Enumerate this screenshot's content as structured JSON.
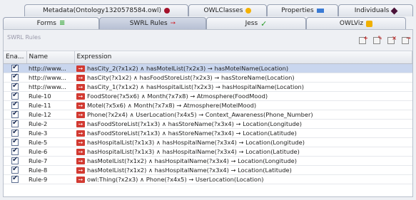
{
  "tabs_row1": [
    {
      "label": "Metadata(Ontology1320578584.owl)",
      "icon": "metadata-icon"
    },
    {
      "label": "OWLClasses",
      "icon": "owl-classes-icon"
    },
    {
      "label": "Properties",
      "icon": "properties-icon"
    },
    {
      "label": "Individuals",
      "icon": "individuals-icon"
    }
  ],
  "tabs_row2": [
    {
      "label": "Forms",
      "icon": "forms-icon"
    },
    {
      "label": "SWRL Rules",
      "icon": "swrl-rules-icon",
      "active": true
    },
    {
      "label": "Jess",
      "icon": "jess-icon"
    },
    {
      "label": "OWLViz",
      "icon": "owlviz-icon"
    }
  ],
  "panel": {
    "title": "SWRL Rules",
    "tools": [
      "new-rule-icon",
      "edit-rule-icon",
      "delete-rule-icon",
      "import-rule-icon"
    ]
  },
  "table": {
    "headers": [
      "Ena...",
      "Name",
      "Expression"
    ],
    "rows": [
      {
        "enabled": true,
        "name": "http://www...",
        "expression": "hasCity_2(?x1x2)  ∧  hasMotelList(?x2x3) → hasMotelName(Location)"
      },
      {
        "enabled": true,
        "name": "http://www...",
        "expression": "hasCity(?x1x2)  ∧  hasFoodStoreList(?x2x3)  →  hasStoreName(Location)"
      },
      {
        "enabled": true,
        "name": "http://www...",
        "expression": "hasCity_1(?x1x2)  ∧  hasHospitalList(?x2x3)  →  hasHospitalName(Location)"
      },
      {
        "enabled": true,
        "name": "Rule-10",
        "expression": "FoodStore(?x5x6)  ∧  Month(?x7x8)  →  Atmosphere(FoodMood)"
      },
      {
        "enabled": true,
        "name": "Rule-11",
        "expression": "Motel(?x5x6)  ∧  Month(?x7x8)  →  Atmosphere(MotelMood)"
      },
      {
        "enabled": true,
        "name": "Rule-12",
        "expression": "Phone(?x2x4)  ∧  UserLocation(?x4x5)  →  Context_Awareness(Phone_Number)"
      },
      {
        "enabled": true,
        "name": "Rule-2",
        "expression": "hasFoodStoreList(?x1x3)  ∧  hasStoreName(?x3x4)  →  Location(Longitude)"
      },
      {
        "enabled": true,
        "name": "Rule-3",
        "expression": "hasFoodStoreList(?x1x3)  ∧  hasStoreName(?x3x4)  →  Location(Latitude)"
      },
      {
        "enabled": true,
        "name": "Rule-5",
        "expression": "hasHospitalList(?x1x3)  ∧  hasHospitalName(?x3x4)  →  Location(Longitude)"
      },
      {
        "enabled": true,
        "name": "Rule-6",
        "expression": "hasHospitalList(?x1x3)  ∧  hasHospitalName(?x3x4)  →  Location(Latitude)"
      },
      {
        "enabled": true,
        "name": "Rule-7",
        "expression": "hasMotelList(?x1x2)  ∧  hasHospitalName(?x3x4)  →  Location(Longitude)"
      },
      {
        "enabled": true,
        "name": "Rule-8",
        "expression": "hasMotelList(?x1x2)  ∧  hasHospitalName(?x3x4)  →  Location(Latitude)"
      },
      {
        "enabled": true,
        "name": "Rule-9",
        "expression": "owl:Thing(?x2x3)  ∧  Phone(?x4x5)  →  UserLocation(Location)"
      }
    ]
  },
  "colors": {
    "accent_red": "#d23a32",
    "selection": "#c9d6ee",
    "tab_active": "#b7c0d4"
  }
}
